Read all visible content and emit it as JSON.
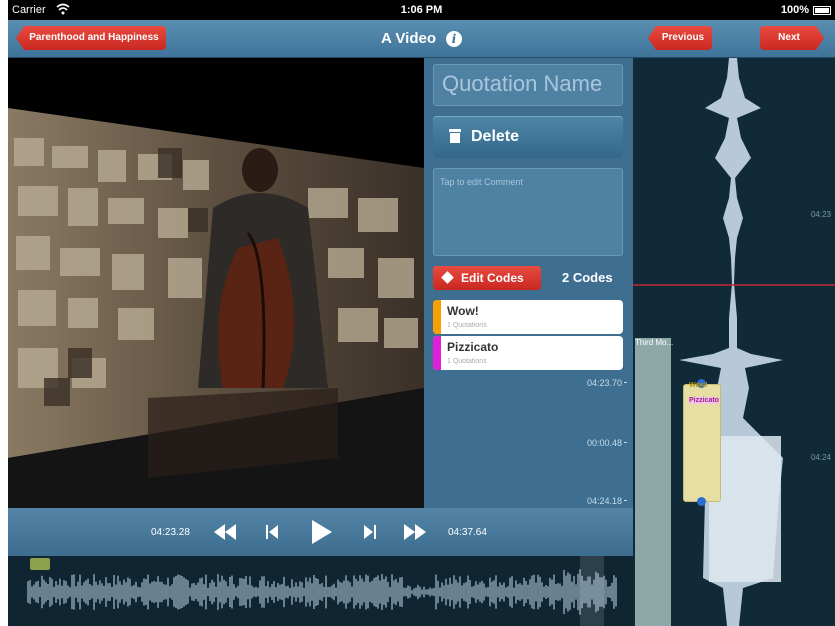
{
  "statusbar": {
    "carrier": "Carrier",
    "time": "1:06 PM",
    "battery": "100%"
  },
  "navbar": {
    "back_label": "Parenthood and Happiness",
    "title": "A Video",
    "previous_label": "Previous",
    "next_label": "Next"
  },
  "quotation": {
    "name_placeholder": "Quotation Name",
    "delete_label": "Delete",
    "comment_placeholder": "Tap to edit Comment",
    "edit_codes_label": "Edit Codes",
    "codes_count": "2 Codes",
    "codes": [
      {
        "name": "Wow!",
        "sub": "1 Quotations",
        "color": "#f5a000"
      },
      {
        "name": "Pizzicato",
        "sub": "1 Quotations",
        "color": "#e020d8"
      }
    ],
    "timeline_labels": [
      "04:23.70",
      "00:00.48",
      "04:24.18"
    ]
  },
  "right_panel": {
    "time_marks": [
      "04:23",
      "04:24"
    ],
    "column_label": "Third Mo...",
    "card_codes": [
      "Wow!",
      "Pizzicato"
    ]
  },
  "player": {
    "current_time": "04:23.28",
    "total_time": "04:37.64"
  },
  "colors": {
    "accent_red": "#d3342a",
    "nav_blue": "#4a80a6",
    "panel_blue": "#3e6f91"
  }
}
